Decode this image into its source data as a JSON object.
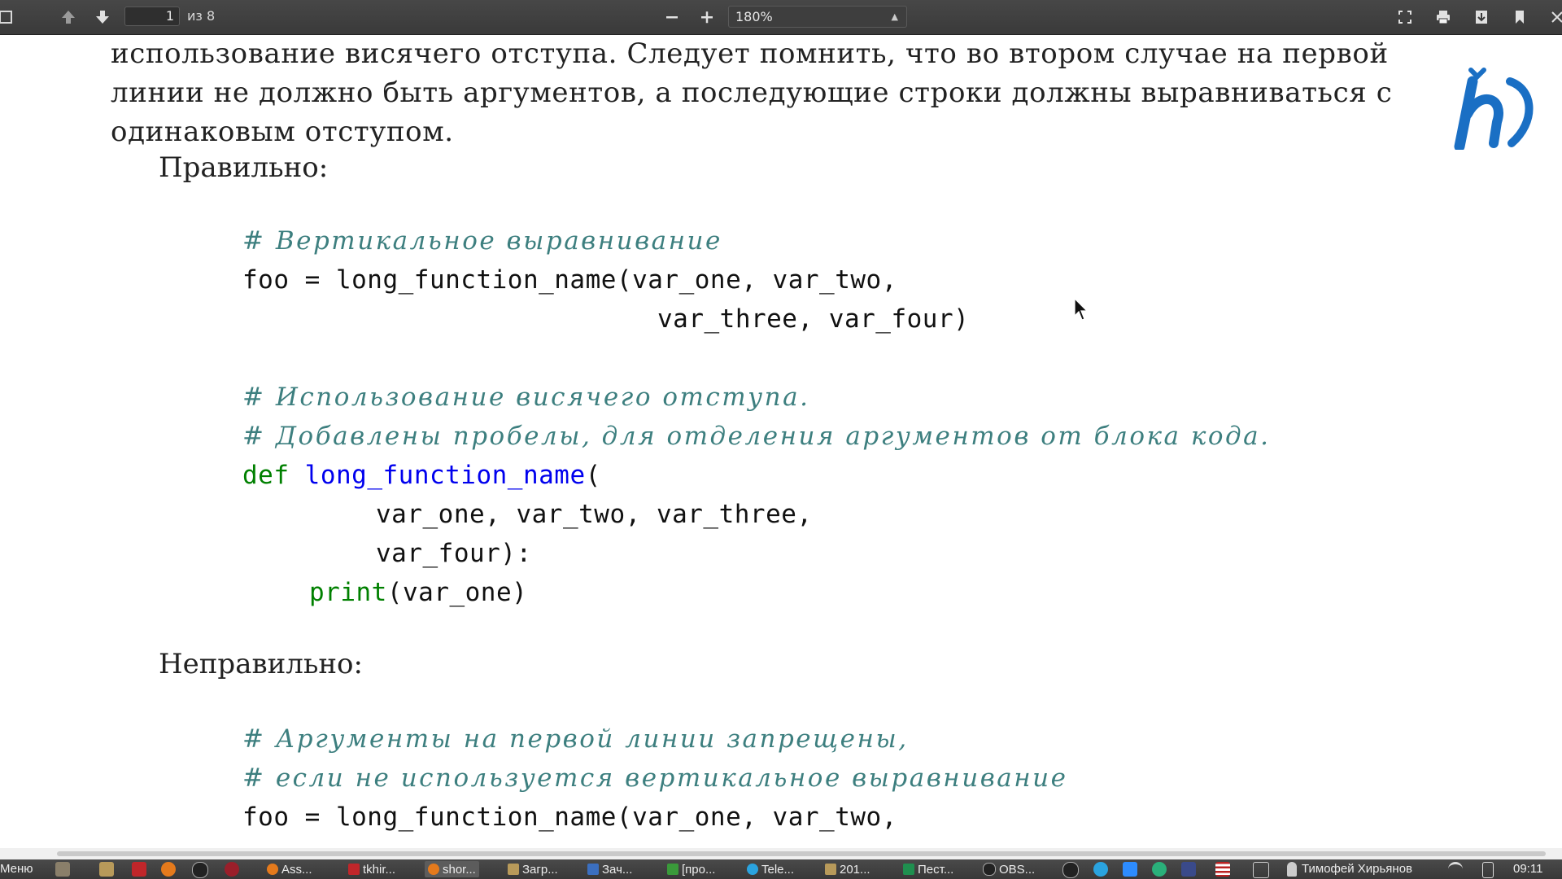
{
  "toolbar": {
    "page_current": "1",
    "page_total": "из 8",
    "zoom_value": "180%",
    "zoom_out_icon": "minus-icon",
    "zoom_in_icon": "plus-icon",
    "prev_icon": "arrow-up-icon",
    "next_icon": "arrow-down-icon"
  },
  "document": {
    "intro_lines": [
      "использование висячего отступа. Следует помнить, что во втором случае на первой",
      "линии не должно быть аргументов, а последующие строки должны выравниваться с",
      "одинаковым отступом."
    ],
    "heading_correct": "Правильно:",
    "heading_incorrect": "Неправильно:",
    "code_correct": {
      "comment1": "# Вертикальное выравнивание",
      "line1": "foo = long_function_name(var_one, var_two,",
      "line2": "var_three, var_four)",
      "comment2": "# Использование висячего отступа.",
      "comment3": "# Добавлены пробелы, для отделения аргументов от блока кода.",
      "def_kw": "def",
      "def_name": "long_function_name",
      "def_paren": "(",
      "args1": "var_one, var_two, var_three,",
      "args2": "var_four):",
      "print_kw": "print",
      "print_args": "(var_one)"
    },
    "code_incorrect": {
      "comment1": "# Аргументы на первой линии запрещены,",
      "comment2": "# если не используется вертикальное выравнивание",
      "line1": "foo = long_function_name(var_one, var_two,"
    }
  },
  "taskbar": {
    "menu_label": "Меню",
    "tasks": [
      "Ass...",
      "tkhir...",
      "shor...",
      "Загр...",
      "Зач...",
      "[про...",
      "Tele...",
      "201...",
      "Пест...",
      "OBS..."
    ],
    "user": "Тимофей Хирьянов",
    "clock": "09:11"
  },
  "colors": {
    "comment": "#3d7f7f",
    "keyword": "#008000",
    "function": "#0000ee",
    "logo": "#1a6fc4"
  }
}
